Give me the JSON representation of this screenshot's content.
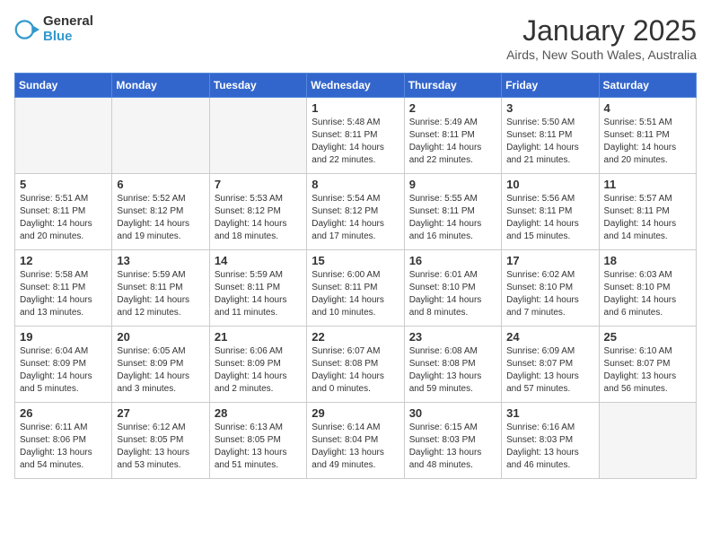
{
  "header": {
    "logo_general": "General",
    "logo_blue": "Blue",
    "month_title": "January 2025",
    "subtitle": "Airds, New South Wales, Australia"
  },
  "weekdays": [
    "Sunday",
    "Monday",
    "Tuesday",
    "Wednesday",
    "Thursday",
    "Friday",
    "Saturday"
  ],
  "weeks": [
    [
      {
        "day": "",
        "info": ""
      },
      {
        "day": "",
        "info": ""
      },
      {
        "day": "",
        "info": ""
      },
      {
        "day": "1",
        "info": "Sunrise: 5:48 AM\nSunset: 8:11 PM\nDaylight: 14 hours\nand 22 minutes."
      },
      {
        "day": "2",
        "info": "Sunrise: 5:49 AM\nSunset: 8:11 PM\nDaylight: 14 hours\nand 22 minutes."
      },
      {
        "day": "3",
        "info": "Sunrise: 5:50 AM\nSunset: 8:11 PM\nDaylight: 14 hours\nand 21 minutes."
      },
      {
        "day": "4",
        "info": "Sunrise: 5:51 AM\nSunset: 8:11 PM\nDaylight: 14 hours\nand 20 minutes."
      }
    ],
    [
      {
        "day": "5",
        "info": "Sunrise: 5:51 AM\nSunset: 8:11 PM\nDaylight: 14 hours\nand 20 minutes."
      },
      {
        "day": "6",
        "info": "Sunrise: 5:52 AM\nSunset: 8:12 PM\nDaylight: 14 hours\nand 19 minutes."
      },
      {
        "day": "7",
        "info": "Sunrise: 5:53 AM\nSunset: 8:12 PM\nDaylight: 14 hours\nand 18 minutes."
      },
      {
        "day": "8",
        "info": "Sunrise: 5:54 AM\nSunset: 8:12 PM\nDaylight: 14 hours\nand 17 minutes."
      },
      {
        "day": "9",
        "info": "Sunrise: 5:55 AM\nSunset: 8:11 PM\nDaylight: 14 hours\nand 16 minutes."
      },
      {
        "day": "10",
        "info": "Sunrise: 5:56 AM\nSunset: 8:11 PM\nDaylight: 14 hours\nand 15 minutes."
      },
      {
        "day": "11",
        "info": "Sunrise: 5:57 AM\nSunset: 8:11 PM\nDaylight: 14 hours\nand 14 minutes."
      }
    ],
    [
      {
        "day": "12",
        "info": "Sunrise: 5:58 AM\nSunset: 8:11 PM\nDaylight: 14 hours\nand 13 minutes."
      },
      {
        "day": "13",
        "info": "Sunrise: 5:59 AM\nSunset: 8:11 PM\nDaylight: 14 hours\nand 12 minutes."
      },
      {
        "day": "14",
        "info": "Sunrise: 5:59 AM\nSunset: 8:11 PM\nDaylight: 14 hours\nand 11 minutes."
      },
      {
        "day": "15",
        "info": "Sunrise: 6:00 AM\nSunset: 8:11 PM\nDaylight: 14 hours\nand 10 minutes."
      },
      {
        "day": "16",
        "info": "Sunrise: 6:01 AM\nSunset: 8:10 PM\nDaylight: 14 hours\nand 8 minutes."
      },
      {
        "day": "17",
        "info": "Sunrise: 6:02 AM\nSunset: 8:10 PM\nDaylight: 14 hours\nand 7 minutes."
      },
      {
        "day": "18",
        "info": "Sunrise: 6:03 AM\nSunset: 8:10 PM\nDaylight: 14 hours\nand 6 minutes."
      }
    ],
    [
      {
        "day": "19",
        "info": "Sunrise: 6:04 AM\nSunset: 8:09 PM\nDaylight: 14 hours\nand 5 minutes."
      },
      {
        "day": "20",
        "info": "Sunrise: 6:05 AM\nSunset: 8:09 PM\nDaylight: 14 hours\nand 3 minutes."
      },
      {
        "day": "21",
        "info": "Sunrise: 6:06 AM\nSunset: 8:09 PM\nDaylight: 14 hours\nand 2 minutes."
      },
      {
        "day": "22",
        "info": "Sunrise: 6:07 AM\nSunset: 8:08 PM\nDaylight: 14 hours\nand 0 minutes."
      },
      {
        "day": "23",
        "info": "Sunrise: 6:08 AM\nSunset: 8:08 PM\nDaylight: 13 hours\nand 59 minutes."
      },
      {
        "day": "24",
        "info": "Sunrise: 6:09 AM\nSunset: 8:07 PM\nDaylight: 13 hours\nand 57 minutes."
      },
      {
        "day": "25",
        "info": "Sunrise: 6:10 AM\nSunset: 8:07 PM\nDaylight: 13 hours\nand 56 minutes."
      }
    ],
    [
      {
        "day": "26",
        "info": "Sunrise: 6:11 AM\nSunset: 8:06 PM\nDaylight: 13 hours\nand 54 minutes."
      },
      {
        "day": "27",
        "info": "Sunrise: 6:12 AM\nSunset: 8:05 PM\nDaylight: 13 hours\nand 53 minutes."
      },
      {
        "day": "28",
        "info": "Sunrise: 6:13 AM\nSunset: 8:05 PM\nDaylight: 13 hours\nand 51 minutes."
      },
      {
        "day": "29",
        "info": "Sunrise: 6:14 AM\nSunset: 8:04 PM\nDaylight: 13 hours\nand 49 minutes."
      },
      {
        "day": "30",
        "info": "Sunrise: 6:15 AM\nSunset: 8:03 PM\nDaylight: 13 hours\nand 48 minutes."
      },
      {
        "day": "31",
        "info": "Sunrise: 6:16 AM\nSunset: 8:03 PM\nDaylight: 13 hours\nand 46 minutes."
      },
      {
        "day": "",
        "info": ""
      }
    ]
  ]
}
